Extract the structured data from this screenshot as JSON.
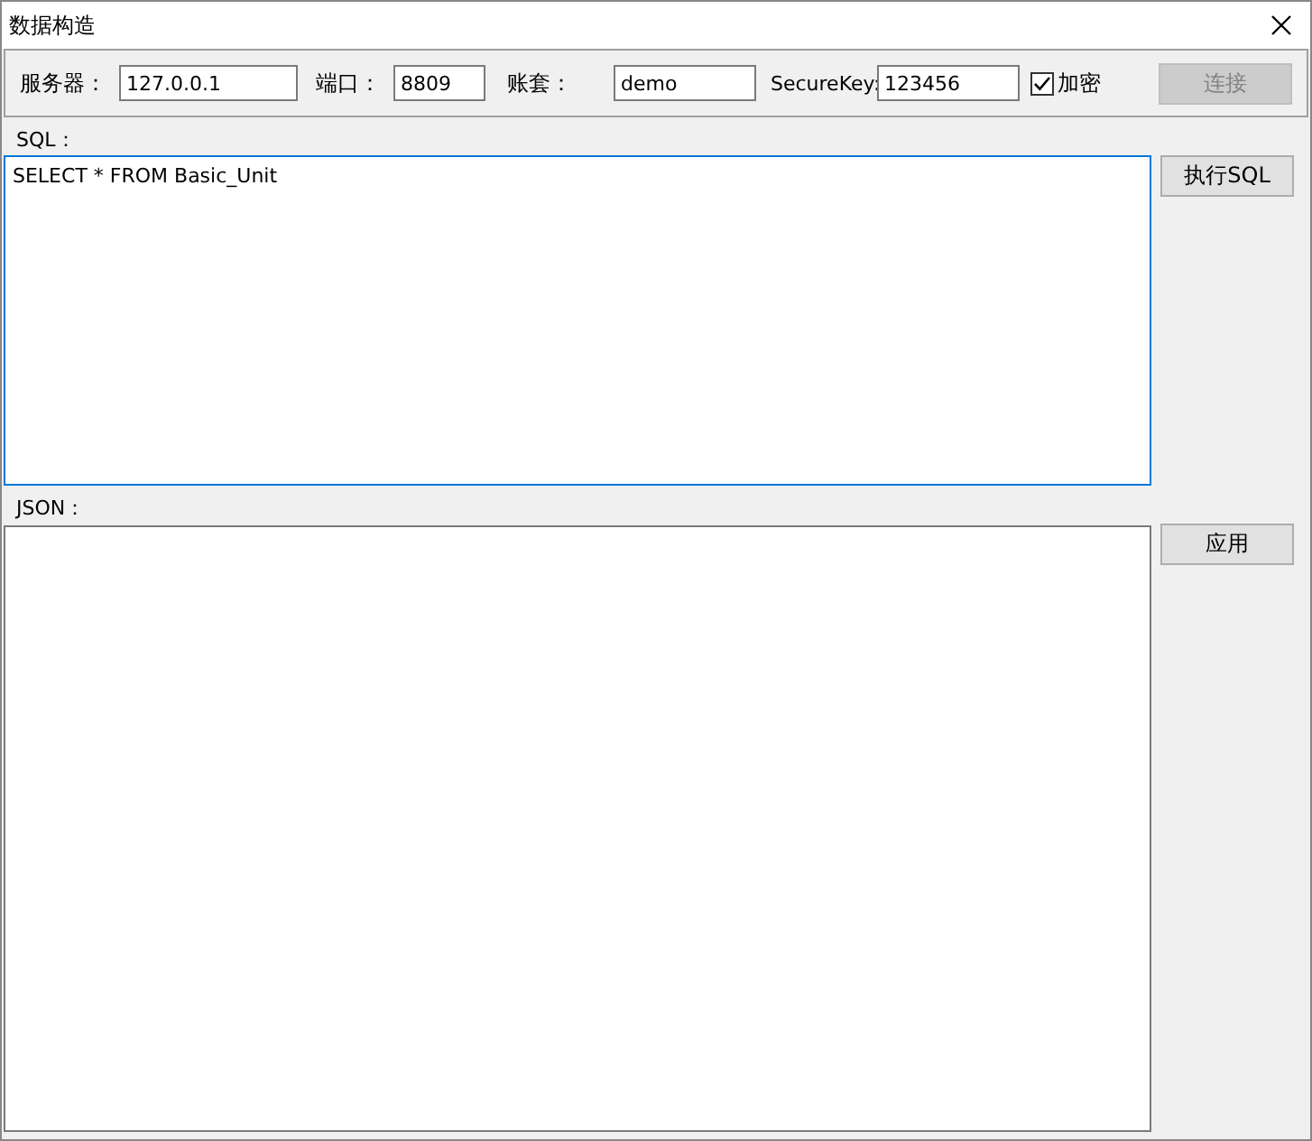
{
  "window": {
    "title": "数据构造"
  },
  "connection": {
    "fields": [
      {
        "label": "服务器：",
        "value": "127.0.0.1"
      },
      {
        "label": "端口：",
        "value": "8809"
      },
      {
        "label": "账套：",
        "value": "demo"
      },
      {
        "label": "SecureKey:",
        "value": "123456"
      }
    ],
    "encrypt": {
      "label": "加密",
      "checked": true
    },
    "connect_button": {
      "label": "连接",
      "disabled": true
    }
  },
  "sql": {
    "label": "SQL：",
    "value": "SELECT * FROM Basic_Unit",
    "focused": true,
    "button": "执行SQL"
  },
  "json": {
    "label": "JSON：",
    "focused": false,
    "button": "应用"
  }
}
